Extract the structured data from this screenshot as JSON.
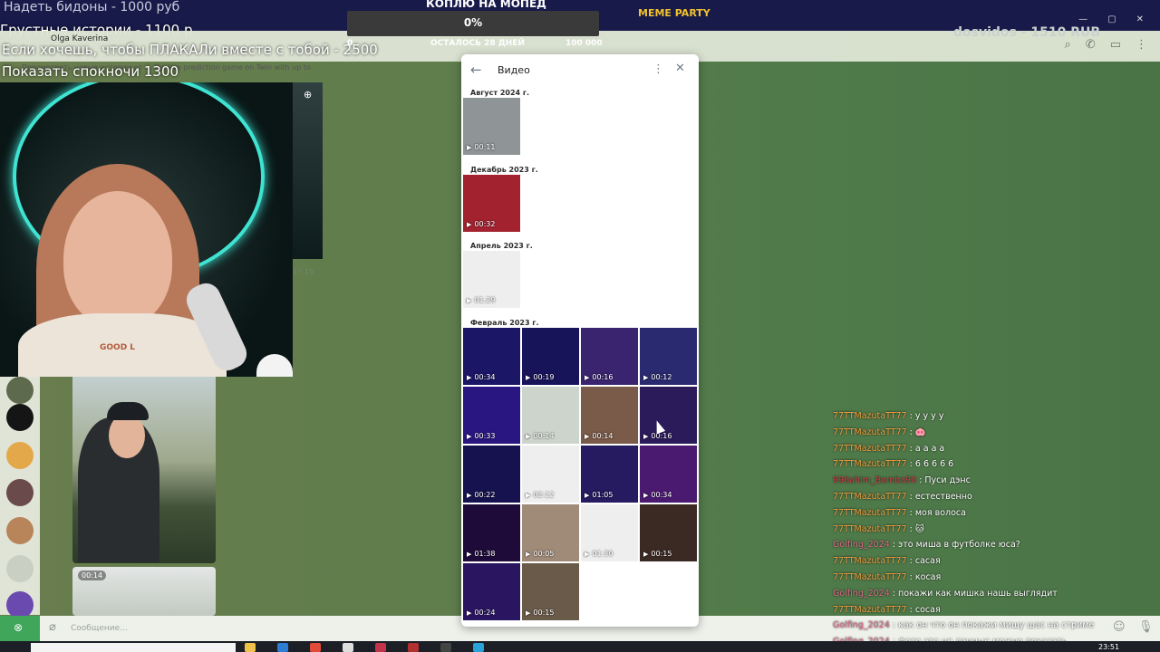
{
  "overlay": {
    "line1": "Надеть бидоны - 1000 руб",
    "line1b": "Грустные истории - 1100 р",
    "line2": "Если хочешь, чтобы ПЛАКАЛи вместе с тобой - 2500",
    "line3": "Показать спокночи 1300",
    "goal_title": "КОПЛЮ НА МОПЕД",
    "goal_percent": "0%",
    "goal_min": "0",
    "goal_remaining": "ОСТАЛОСЬ 28 ДНЕЙ",
    "goal_max": "100 000",
    "donation": "dosvidos - 1510 RUB",
    "meme_banner": "MEME PARTY"
  },
  "telegram": {
    "chat_name": "Olga Kaverina",
    "chat_sub": "Просмотреть новые истории от ... the live prediction game on Twin with up to",
    "top_icons": [
      "search-icon",
      "phone-icon",
      "sidebar-icon",
      "more-icon"
    ],
    "message_time": "17:19",
    "video_duration": "00:14",
    "compose_placeholder": "Сообщение...",
    "webcam_shirt_text": "GOOD L"
  },
  "video_panel": {
    "title": "Видео",
    "sections": [
      {
        "label": "Август 2024 г.",
        "videos": [
          {
            "duration": "00:11",
            "color": "#8f9497"
          }
        ]
      },
      {
        "label": "Декабрь 2023 г.",
        "videos": [
          {
            "duration": "00:32",
            "color": "#a3222f"
          }
        ]
      },
      {
        "label": "Апрель 2023 г.",
        "videos": [
          {
            "duration": "01:29",
            "color": "#eeeeee"
          }
        ]
      },
      {
        "label": "Февраль 2023 г.",
        "videos": [
          {
            "duration": "00:34",
            "color": "#1b1666"
          },
          {
            "duration": "00:19",
            "color": "#18145a"
          },
          {
            "duration": "00:16",
            "color": "#3a2470"
          },
          {
            "duration": "00:12",
            "color": "#2a2a70"
          },
          {
            "duration": "00:33",
            "color": "#2a1680"
          },
          {
            "duration": "00:14",
            "color": "#cdd4cc"
          },
          {
            "duration": "00:14",
            "color": "#7a5a48"
          },
          {
            "duration": "00:16",
            "color": "#2b1b5a"
          },
          {
            "duration": "00:22",
            "color": "#16124f"
          },
          {
            "duration": "02:12",
            "color": "#eeeeee"
          },
          {
            "duration": "01:05",
            "color": "#261a60"
          },
          {
            "duration": "00:34",
            "color": "#4a1a70"
          },
          {
            "duration": "01:38",
            "color": "#1e0b3a"
          },
          {
            "duration": "00:05",
            "color": "#a08a78"
          },
          {
            "duration": "01:30",
            "color": "#eeeeee"
          },
          {
            "duration": "00:15",
            "color": "#3b2a24"
          },
          {
            "duration": "00:24",
            "color": "#2a1660"
          },
          {
            "duration": "00:15",
            "color": "#6a5a4a"
          }
        ]
      }
    ]
  },
  "chat": [
    {
      "user": "77TTMazutaTT77",
      "text": "у у у у",
      "tone": "orange"
    },
    {
      "user": "77TTMazutaTT77",
      "text": "🐽",
      "tone": "orange"
    },
    {
      "user": "77TTMazutaTT77",
      "text": "а а а а",
      "tone": "orange"
    },
    {
      "user": "77TTMazutaTT77",
      "text": "6 6 6 6 6",
      "tone": "orange"
    },
    {
      "user": "996ahim_Bomba90",
      "text": "Пуси дэнс",
      "tone": "red"
    },
    {
      "user": "77TTMazutaTT77",
      "text": "естественно",
      "tone": "orange"
    },
    {
      "user": "77TTMazutaTT77",
      "text": "моя волоса",
      "tone": "orange"
    },
    {
      "user": "77TTMazutaTT77",
      "text": "🐱",
      "tone": "orange"
    },
    {
      "user": "Golfing_2024",
      "text": "это миша в футболке юса?",
      "tone": "pink"
    },
    {
      "user": "77TTMazutaTT77",
      "text": "сасая",
      "tone": "orange"
    },
    {
      "user": "77TTMazutaTT77",
      "text": "косая",
      "tone": "orange"
    },
    {
      "user": "Golfing_2024",
      "text": "покажи как мишка нашь выглядит",
      "tone": "pink"
    },
    {
      "user": "77TTMazutaTT77",
      "text": "сосая",
      "tone": "orange"
    },
    {
      "user": "Golfing_2024",
      "text": "как он что он покажи мишу шас на стриме",
      "tone": "pink"
    },
    {
      "user": "Golfing_2024",
      "text": "фото это не данные можно показать",
      "tone": "pink"
    }
  ],
  "taskbar": {
    "clock": "23:51"
  }
}
